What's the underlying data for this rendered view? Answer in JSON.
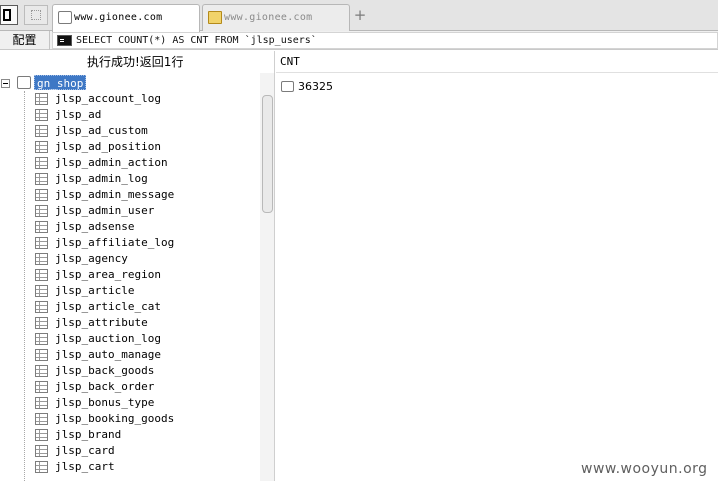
{
  "tabs": [
    {
      "label": "www.gionee.com",
      "active": true,
      "icon": "page-icon"
    },
    {
      "label": "www.gionee.com",
      "active": false,
      "icon": "folder-icon"
    }
  ],
  "new_tab_symbol": "+",
  "toolbar": {
    "config_label": "配置",
    "sql_query": "SELECT COUNT(*) AS CNT FROM `jlsp_users`"
  },
  "status_text": "执行成功!返回1行",
  "tree": {
    "database": "gn_shop",
    "tables": [
      "jlsp_account_log",
      "jlsp_ad",
      "jlsp_ad_custom",
      "jlsp_ad_position",
      "jlsp_admin_action",
      "jlsp_admin_log",
      "jlsp_admin_message",
      "jlsp_admin_user",
      "jlsp_adsense",
      "jlsp_affiliate_log",
      "jlsp_agency",
      "jlsp_area_region",
      "jlsp_article",
      "jlsp_article_cat",
      "jlsp_attribute",
      "jlsp_auction_log",
      "jlsp_auto_manage",
      "jlsp_back_goods",
      "jlsp_back_order",
      "jlsp_bonus_type",
      "jlsp_booking_goods",
      "jlsp_brand",
      "jlsp_card",
      "jlsp_cart"
    ]
  },
  "results": {
    "column": "CNT",
    "rows": [
      "36325"
    ]
  },
  "watermark": "www.wooyun.org",
  "colors": {
    "selection": "#3e78c5",
    "tab_strip": "#e4e4e4",
    "toolbar": "#f0f0f0"
  }
}
